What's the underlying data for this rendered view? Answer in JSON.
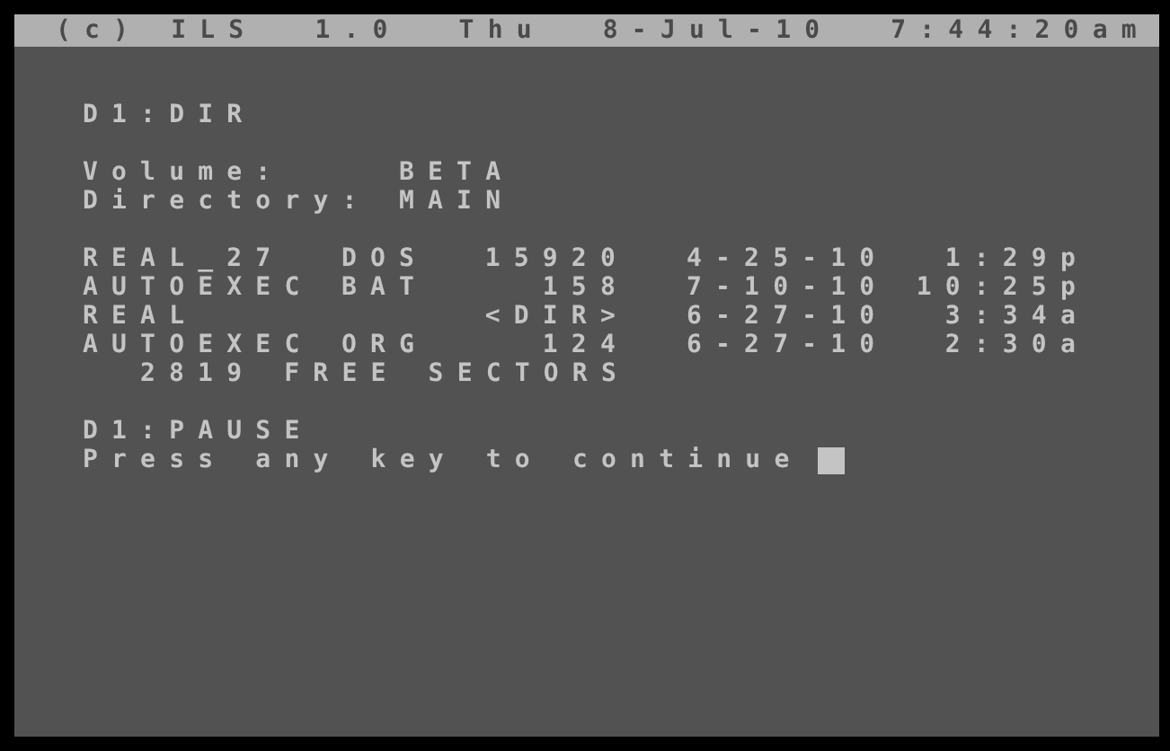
{
  "status_bar": {
    "items": [
      "(c) ILS",
      "1.0",
      "Thu",
      "8-Jul-10",
      "7:44:20am"
    ]
  },
  "command": "D1:DIR",
  "volume": {
    "label": "Volume:",
    "value": "BETA"
  },
  "directory": {
    "label": "Directory:",
    "value": "MAIN"
  },
  "files": [
    {
      "name": "REAL_27",
      "ext": "DOS",
      "size": "15920",
      "date": "4-25-10",
      "time": "1:29p"
    },
    {
      "name": "AUTOEXEC",
      "ext": "BAT",
      "size": "158",
      "date": "7-10-10",
      "time": "10:25p"
    },
    {
      "name": "REAL",
      "size": "<DIR>",
      "date": "6-27-10",
      "time": "3:34a"
    },
    {
      "name": "AUTOEXEC",
      "ext": "ORG",
      "size": "124",
      "date": "6-27-10",
      "time": "2:30a"
    }
  ],
  "free": "2819 FREE SECTORS",
  "pause_command": "D1:PAUSE",
  "prompt": "Press any key to continue"
}
